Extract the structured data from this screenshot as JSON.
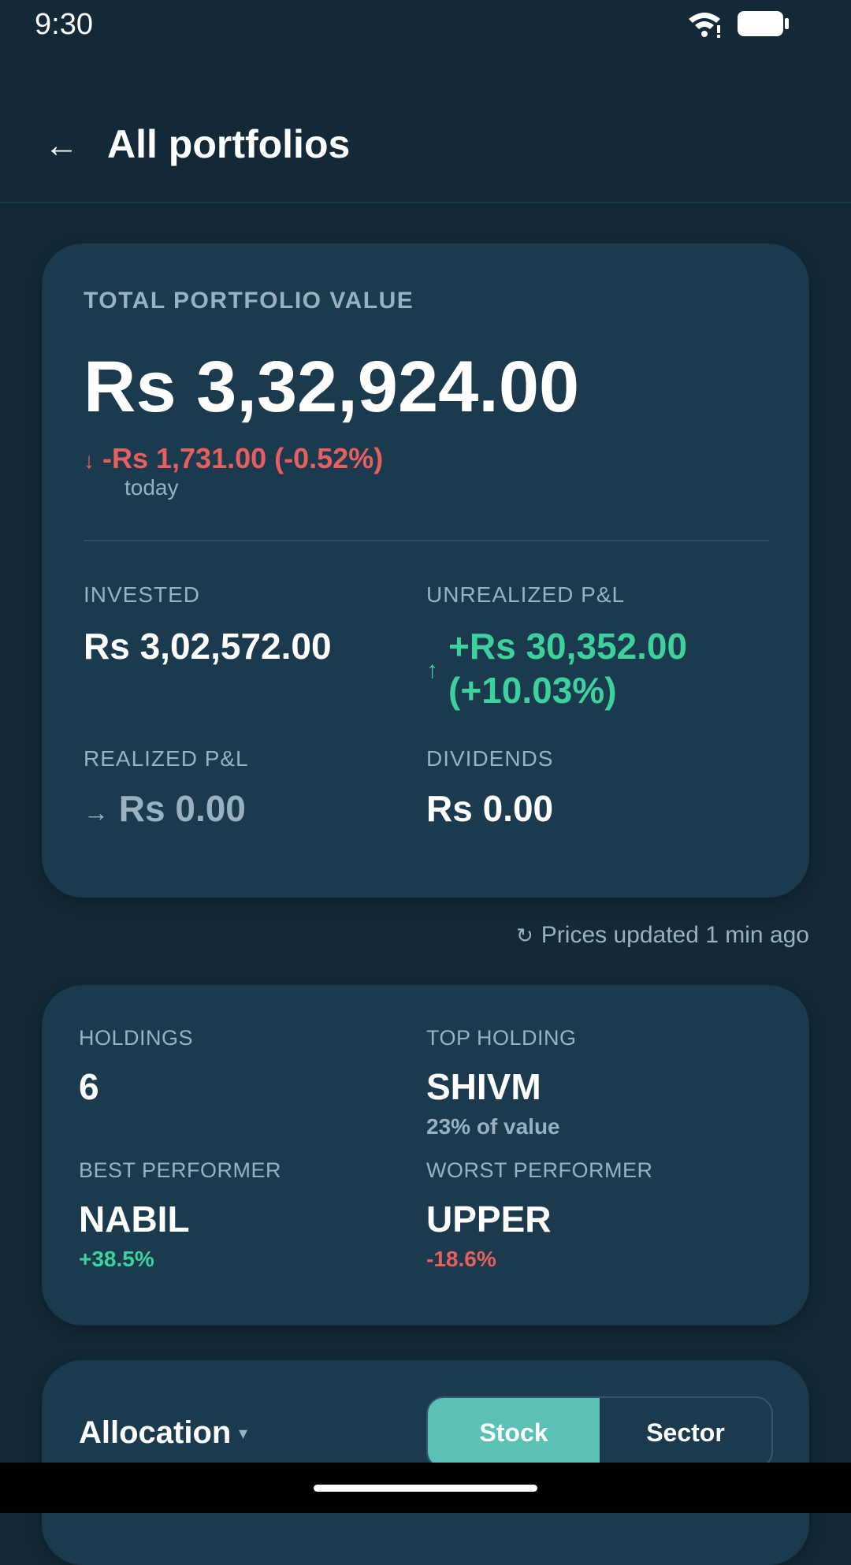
{
  "status_bar": {
    "time": "9:30"
  },
  "appbar": {
    "title": "All portfolios"
  },
  "summary": {
    "total_label": "TOTAL PORTFOLIO VALUE",
    "total_value": "Rs 3,32,924.00",
    "day_change_arrow": "↓",
    "day_change": "-Rs 1,731.00 (-0.52%)",
    "day_note": "today",
    "invested_label": "INVESTED",
    "invested_value": "Rs 3,02,572.00",
    "unrealized_label": "UNREALIZED P&L",
    "unrealized_arrow": "↑",
    "unrealized_line1": "+Rs 30,352.00",
    "unrealized_line2": "(+10.03%)",
    "realized_label": "REALIZED P&L",
    "realized_arrow": "→",
    "realized_value": "Rs 0.00",
    "dividends_label": "DIVIDENDS",
    "dividends_value": "Rs 0.00"
  },
  "refresh": {
    "icon": "↻",
    "text": "Prices updated 1 min ago"
  },
  "stats": {
    "holdings_label": "HOLDINGS",
    "holdings_value": "6",
    "top_label": "TOP HOLDING",
    "top_value": "SHIVM",
    "top_sub": "23% of value",
    "best_label": "BEST PERFORMER",
    "best_value": "NABIL",
    "best_sub": "+38.5%",
    "worst_label": "WORST PERFORMER",
    "worst_value": "UPPER",
    "worst_sub": "-18.6%"
  },
  "allocation": {
    "title": "Allocation",
    "caret": "▾",
    "options": [
      "Stock",
      "Sector"
    ],
    "selected": "Stock"
  },
  "colors": {
    "background": "#132937",
    "card": "#1b3a4d",
    "gain": "#3dd19d",
    "loss": "#e85f5f",
    "accent": "#5bc1b6",
    "muted": "#9ab1bf"
  }
}
